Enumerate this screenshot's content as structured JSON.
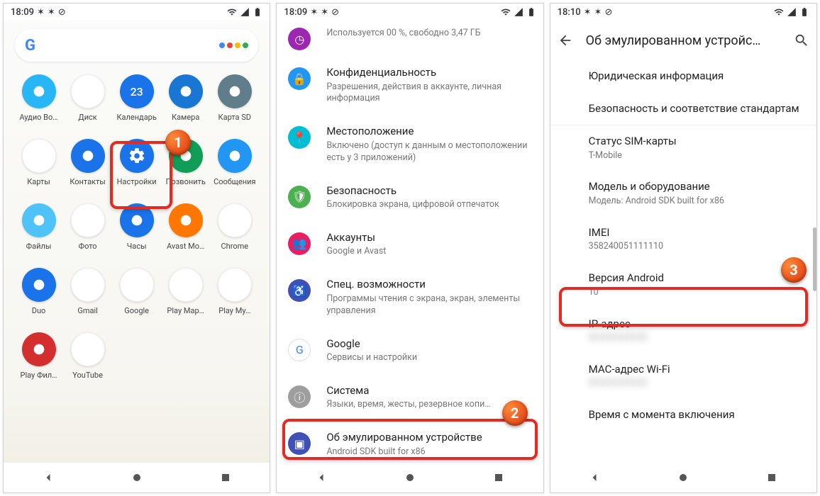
{
  "status": {
    "time1": "18:09",
    "time2": "18:09",
    "time3": "18:10"
  },
  "drawer": {
    "apps": [
      {
        "label": "Аудио Во…",
        "bg": "#29b6f6",
        "icon": "audio"
      },
      {
        "label": "Диск",
        "bg": "#ffffff",
        "icon": "drive"
      },
      {
        "label": "Календарь",
        "bg": "#1a73e8",
        "icon": "cal",
        "text": "23"
      },
      {
        "label": "Камера",
        "bg": "#1976d2",
        "icon": "camera"
      },
      {
        "label": "Карта SD",
        "bg": "#607d8b",
        "icon": "sd"
      },
      {
        "label": "Карты",
        "bg": "#ffffff",
        "icon": "maps"
      },
      {
        "label": "Контакты",
        "bg": "#1a73e8",
        "icon": "contacts"
      },
      {
        "label": "Настройки",
        "bg": "#1a73e8",
        "icon": "settings"
      },
      {
        "label": "Позвонить",
        "bg": "#0f9d58",
        "icon": "phone"
      },
      {
        "label": "Сообщения",
        "bg": "#2196f3",
        "icon": "sms"
      },
      {
        "label": "Файлы",
        "bg": "#4fc3f7",
        "icon": "files"
      },
      {
        "label": "Фото",
        "bg": "#ffffff",
        "icon": "photos"
      },
      {
        "label": "Часы",
        "bg": "#1a73e8",
        "icon": "clock"
      },
      {
        "label": "Avast Mo…",
        "bg": "#ff7700",
        "icon": "avast"
      },
      {
        "label": "Chrome",
        "bg": "#ffffff",
        "icon": "chrome"
      },
      {
        "label": "Duo",
        "bg": "#1a73e8",
        "icon": "duo"
      },
      {
        "label": "Gmail",
        "bg": "#ffffff",
        "icon": "gmail"
      },
      {
        "label": "Google",
        "bg": "#ffffff",
        "icon": "google"
      },
      {
        "label": "Play Мар…",
        "bg": "#ffffff",
        "icon": "play"
      },
      {
        "label": "Play Му…",
        "bg": "#ffffff",
        "icon": "playm"
      },
      {
        "label": "Play Фил…",
        "bg": "#d32f2f",
        "icon": "playf"
      },
      {
        "label": "YouTube",
        "bg": "#ffffff",
        "icon": "yt"
      }
    ]
  },
  "settings": {
    "storage_sub": "Используется 00 %, свободно 3,47 ГБ",
    "items": [
      {
        "title": "Конфиденциальность",
        "sub": "Разрешения, действия в аккаунте, личная информация",
        "bg": "#2196f3"
      },
      {
        "title": "Местоположение",
        "sub": "Включено (доступ к данным о местоположении есть у 3 приложений)",
        "bg": "#00bcd4"
      },
      {
        "title": "Безопасность",
        "sub": "Блокировка экрана, цифровой отпечаток",
        "bg": "#4caf50"
      },
      {
        "title": "Аккаунты",
        "sub": "Google и Avast",
        "bg": "#e91e63"
      },
      {
        "title": "Спец. возможности",
        "sub": "Программы чтения с экрана, экран, элементы управления",
        "bg": "#3f51b5"
      },
      {
        "title": "Google",
        "sub": "Сервисы и настройки",
        "bg": "#ffffff"
      },
      {
        "title": "Система",
        "sub": "Языки, время, жесты, резервное копи…",
        "bg": "#9e9e9e"
      },
      {
        "title": "Об эмулированном устройстве",
        "sub": "Android SDK built for x86",
        "bg": "#3f51b5"
      }
    ]
  },
  "about": {
    "appbar_title": "Об эмулированном устройс…",
    "rows": [
      {
        "title": "Юридическая информация",
        "sub": ""
      },
      {
        "title": "Безопасность и соответствие стандартам",
        "sub": ""
      },
      {
        "title": "Статус SIM-карты",
        "sub": "T-Mobile"
      },
      {
        "title": "Модель и оборудование",
        "sub": "Модель: Android SDK built for x86"
      },
      {
        "title": "IMEI",
        "sub": "358240051111110"
      },
      {
        "title": "Версия Android",
        "sub": "10"
      },
      {
        "title": "IP-адрес",
        "sub": "████████"
      },
      {
        "title": "MAC-адрес Wi-Fi",
        "sub": "████████"
      },
      {
        "title": "Время с момента включения",
        "sub": ""
      }
    ]
  },
  "steps": {
    "s1": "1",
    "s2": "2",
    "s3": "3"
  }
}
